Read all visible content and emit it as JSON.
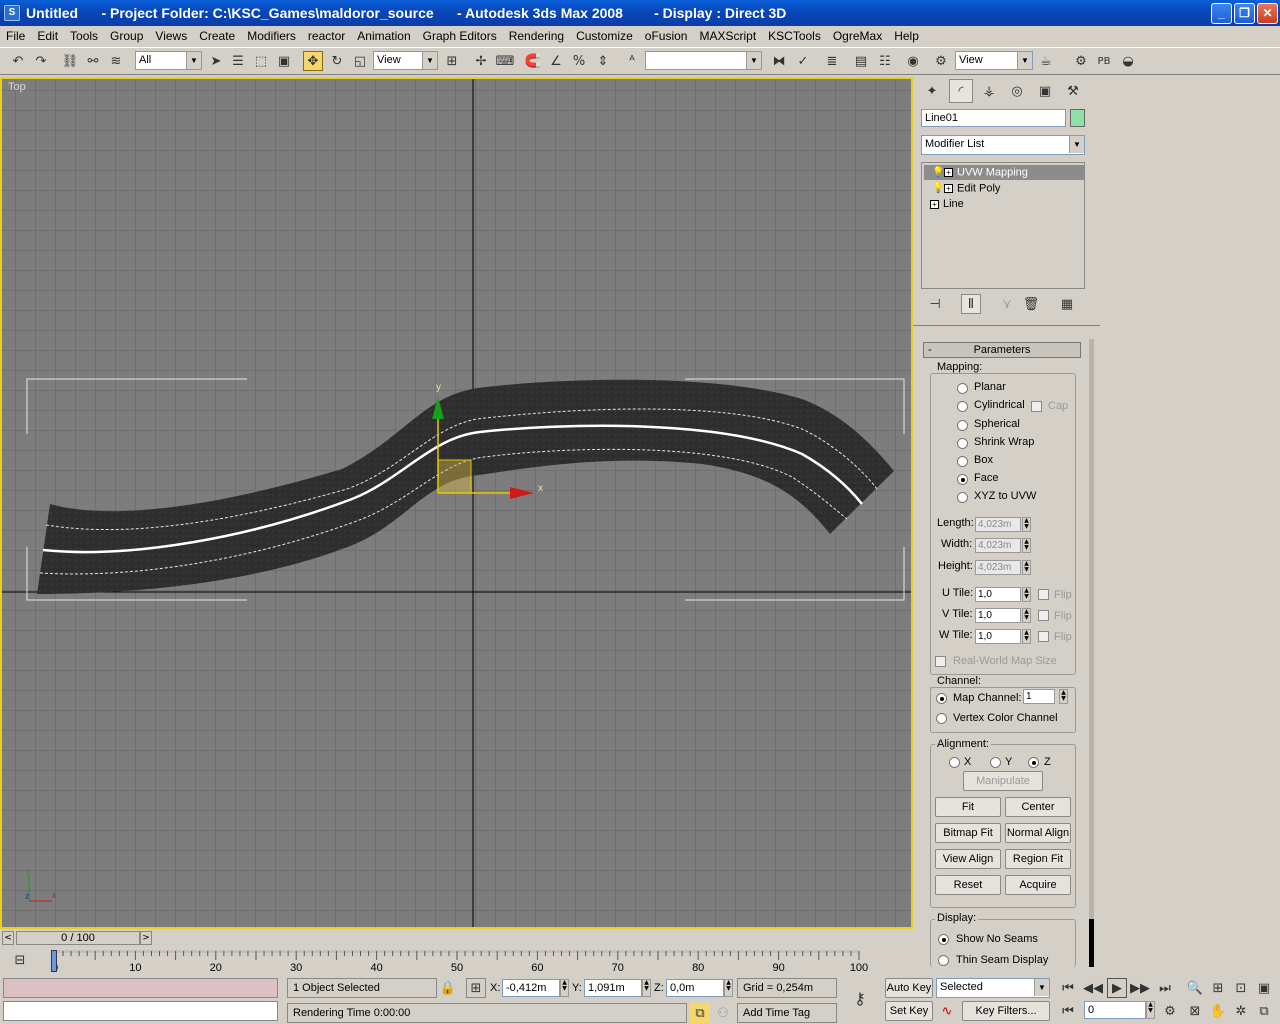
{
  "window": {
    "title": "Untitled      - Project Folder: C:\\KSC_Games\\maldoror_source      - Autodesk 3ds Max 2008        - Display : Direct 3D",
    "minimize": "_",
    "maximize": "❐",
    "close": "✕"
  },
  "menu": [
    "File",
    "Edit",
    "Tools",
    "Group",
    "Views",
    "Create",
    "Modifiers",
    "reactor",
    "Animation",
    "Graph Editors",
    "Rendering",
    "Customize",
    "oFusion",
    "MAXScript",
    "KSCTools",
    "OgreMax",
    "Help"
  ],
  "toolbar": {
    "selection_filter": "All",
    "ref_coord": "View",
    "named_selection": "",
    "render_view": "View",
    "pb_label": "PB"
  },
  "viewport": {
    "label": "Top",
    "axis_x": "x",
    "axis_y": "y",
    "axis_z": "z",
    "mini_x": "x",
    "mini_y": "y",
    "mini_z": "z"
  },
  "command_panel": {
    "object_name": "Line01",
    "object_color": "#8fe0a8",
    "modifier_list": "Modifier List",
    "stack": [
      "UVW Mapping",
      "Edit Poly",
      "Line"
    ],
    "rollout_title": "Parameters",
    "rollout_toggle": "-",
    "mapping": {
      "label": "Mapping:",
      "options": [
        "Planar",
        "Cylindrical",
        "Spherical",
        "Shrink Wrap",
        "Box",
        "Face",
        "XYZ to UVW"
      ],
      "selected": "Face",
      "cap": "Cap"
    },
    "dims": {
      "length_label": "Length:",
      "length": "4,023m",
      "width_label": "Width:",
      "width": "4,023m",
      "height_label": "Height:",
      "height": "4,023m"
    },
    "tiles": {
      "u_label": "U Tile:",
      "u": "1,0",
      "v_label": "V Tile:",
      "v": "1,0",
      "w_label": "W Tile:",
      "w": "1,0",
      "flip": "Flip"
    },
    "real_world": "Real-World Map Size",
    "channel": {
      "label": "Channel:",
      "map_channel": "Map Channel:",
      "map_channel_value": "1",
      "vertex_color": "Vertex Color Channel"
    },
    "alignment": {
      "label": "Alignment:",
      "x": "X",
      "y": "Y",
      "z": "Z",
      "manipulate": "Manipulate",
      "fit": "Fit",
      "center": "Center",
      "bitmap_fit": "Bitmap Fit",
      "normal_align": "Normal Align",
      "view_align": "View Align",
      "region_fit": "Region Fit",
      "reset": "Reset",
      "acquire": "Acquire"
    },
    "display": {
      "label": "Display:",
      "show_no_seams": "Show No Seams",
      "thin_seam": "Thin Seam Display"
    }
  },
  "timeline": {
    "slider_text": "0 / 100",
    "ticks": [
      "0",
      "10",
      "20",
      "30",
      "40",
      "50",
      "60",
      "70",
      "80",
      "90",
      "100"
    ]
  },
  "status": {
    "selection": "1 Object Selected",
    "rendering_time": "Rendering Time  0:00:00",
    "x_label": "X:",
    "x": "-0,412m",
    "y_label": "Y:",
    "y": "1,091m",
    "z_label": "Z:",
    "z": "0,0m",
    "grid": "Grid = 0,254m",
    "add_time_tag": "Add Time Tag",
    "auto_key": "Auto Key",
    "set_key": "Set Key",
    "key_mode": "Selected",
    "key_filters": "Key Filters...",
    "frame": "0"
  }
}
